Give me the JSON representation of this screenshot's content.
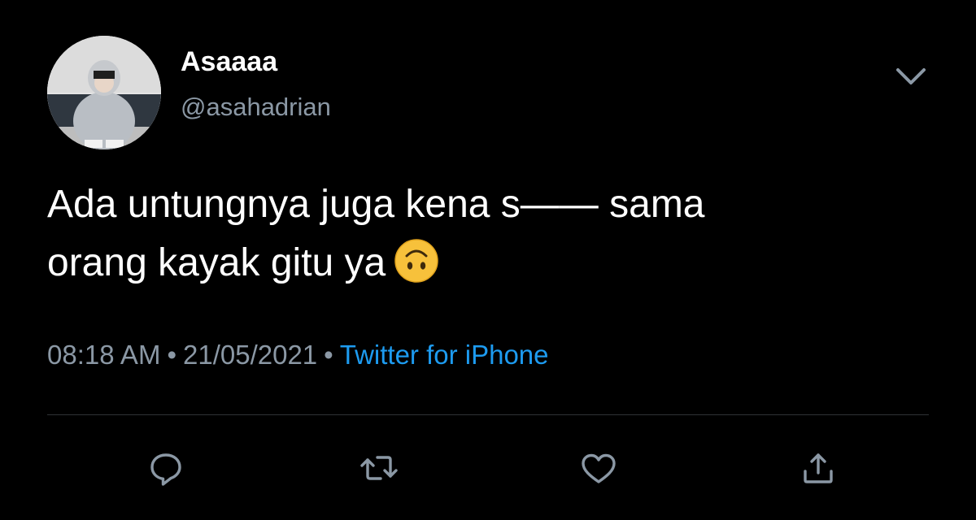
{
  "tweet": {
    "author": {
      "display_name": "Asaaaa",
      "handle": "@asahadrian",
      "avatar_icon": "profile-photo-avatar"
    },
    "menu_icon": "chevron-down-icon",
    "text_line1": "Ada untungnya juga kena s—— sama",
    "text_line2": "orang kayak gitu ya",
    "emoji": "upside-down-face-emoji",
    "time": "08:18 AM",
    "separator": "•",
    "date": "21/05/2021",
    "source": "Twitter for iPhone"
  },
  "actions": {
    "reply_icon": "reply-icon",
    "retweet_icon": "retweet-icon",
    "like_icon": "heart-icon",
    "share_icon": "share-icon"
  },
  "colors": {
    "background": "#000000",
    "text_primary": "#ffffff",
    "text_secondary": "#8b98a5",
    "link": "#1d9bf0",
    "divider": "#2f3336"
  }
}
